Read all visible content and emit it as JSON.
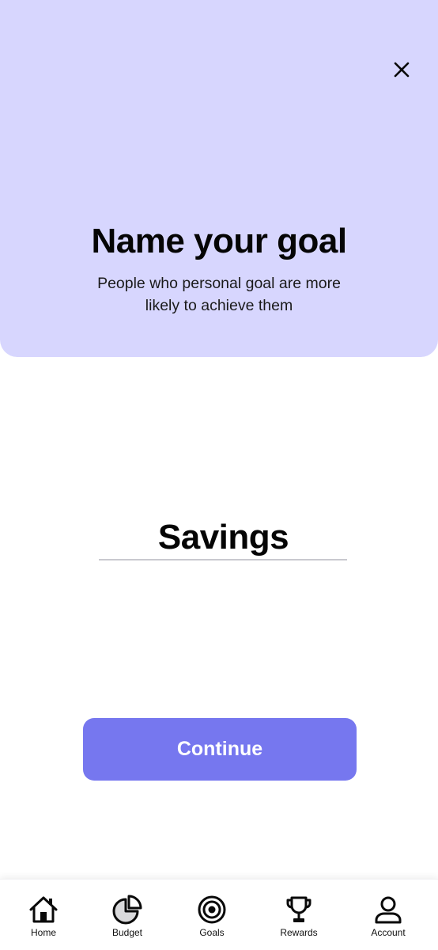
{
  "hero": {
    "title": "Name your goal",
    "subtitle": "People who personal goal are more likely to achieve them",
    "background_color": "#d7d6fe"
  },
  "close": {
    "icon": "close-icon"
  },
  "goal_input": {
    "value": "Savings"
  },
  "continue_button": {
    "label": "Continue",
    "color": "#7677ef"
  },
  "bottom_nav": {
    "items": [
      {
        "label": "Home",
        "icon": "home-icon"
      },
      {
        "label": "Budget",
        "icon": "pie-chart-icon"
      },
      {
        "label": "Goals",
        "icon": "target-icon"
      },
      {
        "label": "Rewards",
        "icon": "trophy-icon"
      },
      {
        "label": "Account",
        "icon": "user-icon"
      }
    ]
  }
}
